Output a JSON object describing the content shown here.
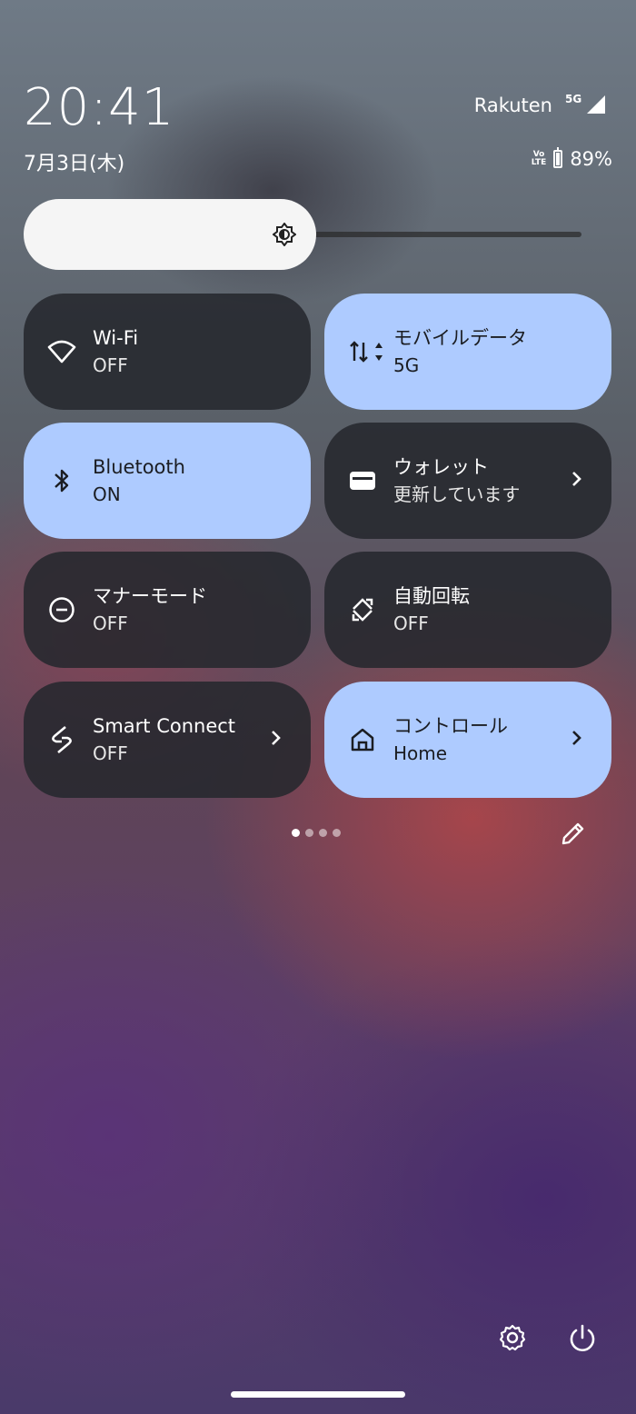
{
  "status": {
    "time": "20:41",
    "date": "7月3日(木)",
    "carrier": "Rakuten",
    "network": "5G",
    "volte": "Vo\nLTE",
    "battery_percent_text": "89%",
    "battery_level": 0.89
  },
  "brightness": {
    "level": 0.5
  },
  "tiles": [
    {
      "title": "Wi-Fi",
      "subtitle": "OFF",
      "state": "off",
      "icon": "wifi-icon"
    },
    {
      "title": "モバイルデータ",
      "subtitle": "5G",
      "state": "on",
      "icon": "mobile-data-icon"
    },
    {
      "title": "Bluetooth",
      "subtitle": "ON",
      "state": "on",
      "icon": "bluetooth-icon"
    },
    {
      "title": "ウォレット",
      "subtitle": "更新しています",
      "state": "off",
      "icon": "wallet-icon",
      "chevron": ">"
    },
    {
      "title": "マナーモード",
      "subtitle": "OFF",
      "state": "off",
      "icon": "do-not-disturb-icon"
    },
    {
      "title": "自動回転",
      "subtitle": "OFF",
      "state": "off",
      "icon": "auto-rotate-icon"
    },
    {
      "title": "Smart Connect",
      "subtitle": "OFF",
      "state": "off",
      "icon": "smart-connect-icon",
      "chevron": ">"
    },
    {
      "title": "コントロール",
      "subtitle": "Home",
      "state": "on",
      "icon": "home-icon",
      "chevron": ">"
    }
  ],
  "pager": {
    "pages": 4,
    "current": 1
  },
  "colors": {
    "tile_on": "#aecbff",
    "tile_off": "#26282e",
    "brightness_knob": "#f5f5f5"
  }
}
